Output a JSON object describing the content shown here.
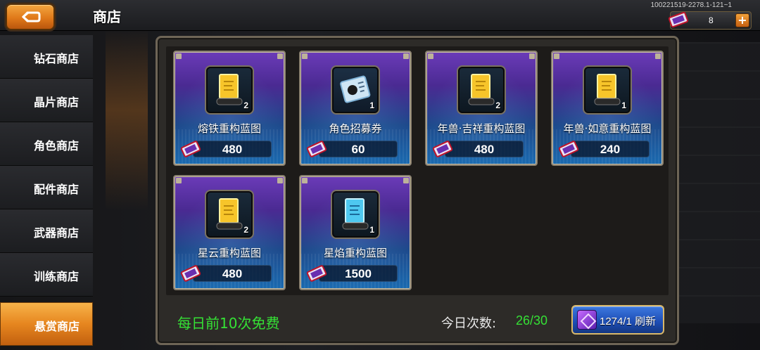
{
  "header": {
    "title": "商店",
    "version": "100221519-2278.1-121~1",
    "currency_value": "8",
    "plus_label": "+"
  },
  "sidebar": {
    "items": [
      {
        "label": "钻石商店"
      },
      {
        "label": "晶片商店"
      },
      {
        "label": "角色商店"
      },
      {
        "label": "配件商店"
      },
      {
        "label": "武器商店"
      },
      {
        "label": "训练商店"
      },
      {
        "label": "悬赏商店",
        "active": true
      }
    ]
  },
  "shop": {
    "items": [
      {
        "name": "熔铁重构蓝图",
        "qty": "2",
        "price": "480",
        "icon": "gold-scroll-icon"
      },
      {
        "name": "角色招募券",
        "qty": "1",
        "price": "60",
        "icon": "recruit-ticket-icon"
      },
      {
        "name": "年兽·吉祥重构蓝图",
        "qty": "2",
        "price": "480",
        "icon": "gold-scroll-icon"
      },
      {
        "name": "年兽·如意重构蓝图",
        "qty": "1",
        "price": "240",
        "icon": "gold-scroll-icon"
      },
      {
        "name": "星云重构蓝图",
        "qty": "2",
        "price": "480",
        "icon": "gold-scroll-icon"
      },
      {
        "name": "星焰重构蓝图",
        "qty": "1",
        "price": "1500",
        "icon": "blue-scroll-icon"
      }
    ]
  },
  "footer": {
    "free_text": "每日前10次免费",
    "count_label": "今日次数:",
    "count_value": "26/30",
    "refresh_label": "1274/1 刷新"
  },
  "colors": {
    "accent_orange": "#e6861f",
    "green_text": "#35e135",
    "card_purple": "#6b3bb8",
    "card_blue": "#1a6ab0"
  }
}
